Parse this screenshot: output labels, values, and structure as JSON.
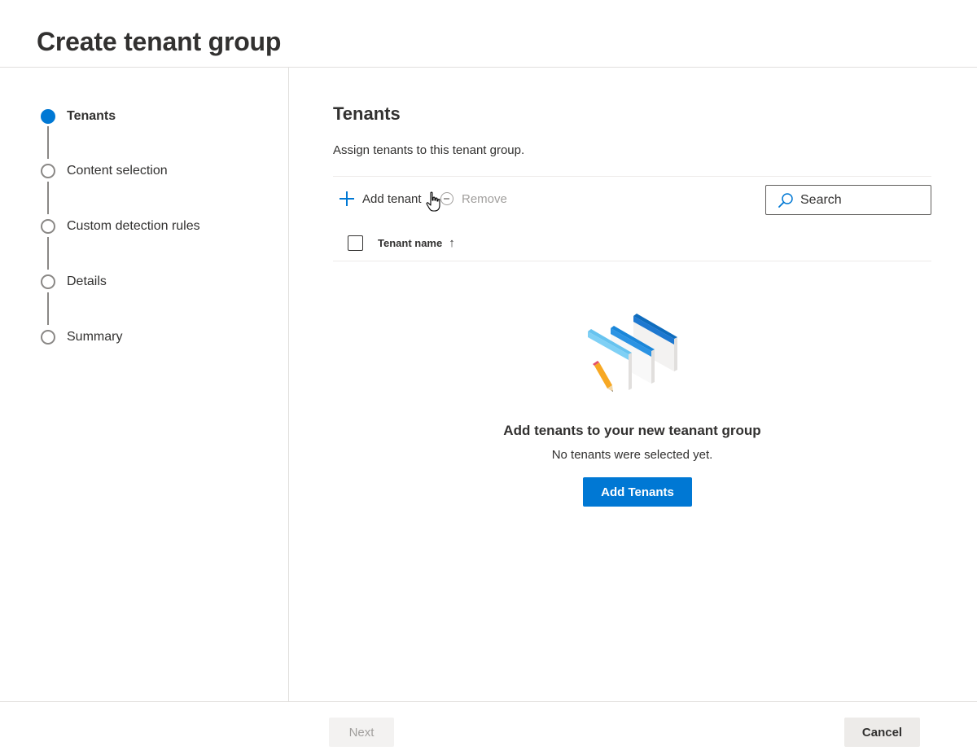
{
  "header": {
    "title": "Create tenant group"
  },
  "steps": [
    {
      "label": "Tenants",
      "active": true
    },
    {
      "label": "Content selection",
      "active": false
    },
    {
      "label": "Custom detection rules",
      "active": false
    },
    {
      "label": "Details",
      "active": false
    },
    {
      "label": "Summary",
      "active": false
    }
  ],
  "main": {
    "title": "Tenants",
    "description": "Assign tenants to this tenant group.",
    "toolbar": {
      "add_label": "Add tenant",
      "remove_label": "Remove"
    },
    "search": {
      "placeholder": "Search"
    },
    "table": {
      "column_name": "Tenant name",
      "sort_icon": "↑"
    },
    "empty_state": {
      "title": "Add tenants to your new teanant group",
      "subtitle": "No tenants were selected yet.",
      "button_label": "Add Tenants"
    }
  },
  "footer": {
    "next_label": "Next",
    "cancel_label": "Cancel"
  },
  "colors": {
    "accent": "#0078d4",
    "text": "#323130",
    "disabled": "#a19f9d"
  }
}
